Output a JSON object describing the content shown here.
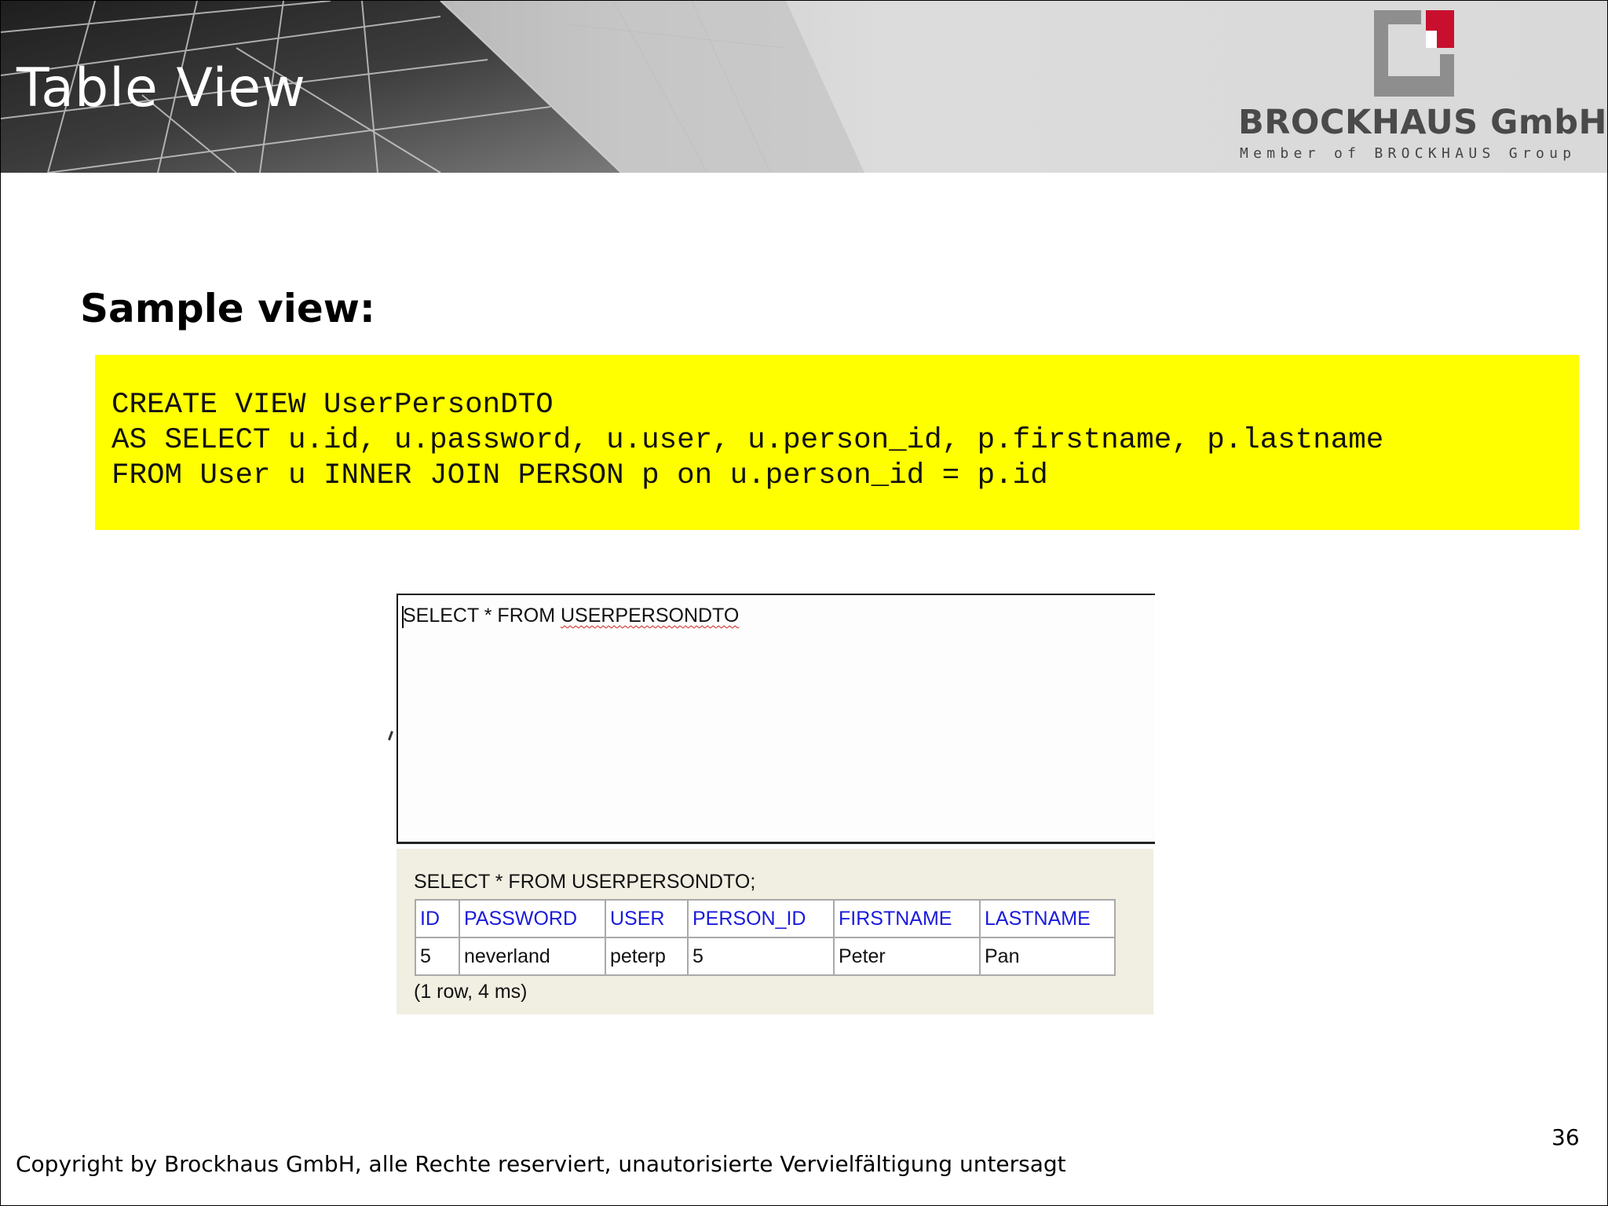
{
  "header": {
    "title": "Table View",
    "company_name": "BROCKHAUS GmbH",
    "company_tagline": "Member of BROCKHAUS Group",
    "logo_icon": "brockhaus-logo-icon",
    "logo_accent_color": "#c8102e"
  },
  "section": {
    "heading": "Sample view:"
  },
  "code": {
    "background_color": "#ffff00",
    "lines": [
      "CREATE VIEW UserPersonDTO",
      "AS SELECT u.id, u.password, u.user, u.person_id, p.firstname, p.lastname",
      "FROM User u INNER JOIN PERSON p on u.person_id = p.id"
    ]
  },
  "editor": {
    "query_prefix": "SELECT * FROM ",
    "query_object": "USERPERSONDTO"
  },
  "results": {
    "query": "SELECT * FROM USERPERSONDTO;",
    "columns": [
      "ID",
      "PASSWORD",
      "USER",
      "PERSON_ID",
      "FIRSTNAME",
      "LASTNAME"
    ],
    "rows": [
      [
        "5",
        "neverland",
        "peterp",
        "5",
        "Peter",
        "Pan"
      ]
    ],
    "status": "(1 row, 4 ms)",
    "header_color": "#1a1adc"
  },
  "footer": {
    "page_number": "36",
    "copyright": "Copyright by Brockhaus GmbH, alle Rechte reserviert, unautorisierte Vervielfältigung untersagt"
  }
}
